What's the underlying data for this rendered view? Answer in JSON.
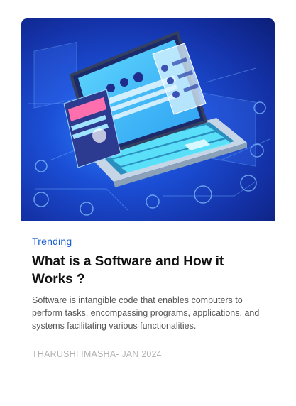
{
  "card": {
    "category": "Trending",
    "title": "What is a Software and How it Works ?",
    "excerpt": "Software is intangible code that enables computers to perform tasks, encompassing programs, applications, and systems facilitating various functionalities.",
    "meta": "THARUSHI IMASHA- JAN 2024"
  },
  "hero": {
    "icon": "laptop-software-illustration",
    "colors": {
      "accent": "#1a5fd0",
      "hero_dark": "#0c1f78",
      "hero_light": "#2f86ff",
      "glow": "#5ff0ff"
    }
  }
}
